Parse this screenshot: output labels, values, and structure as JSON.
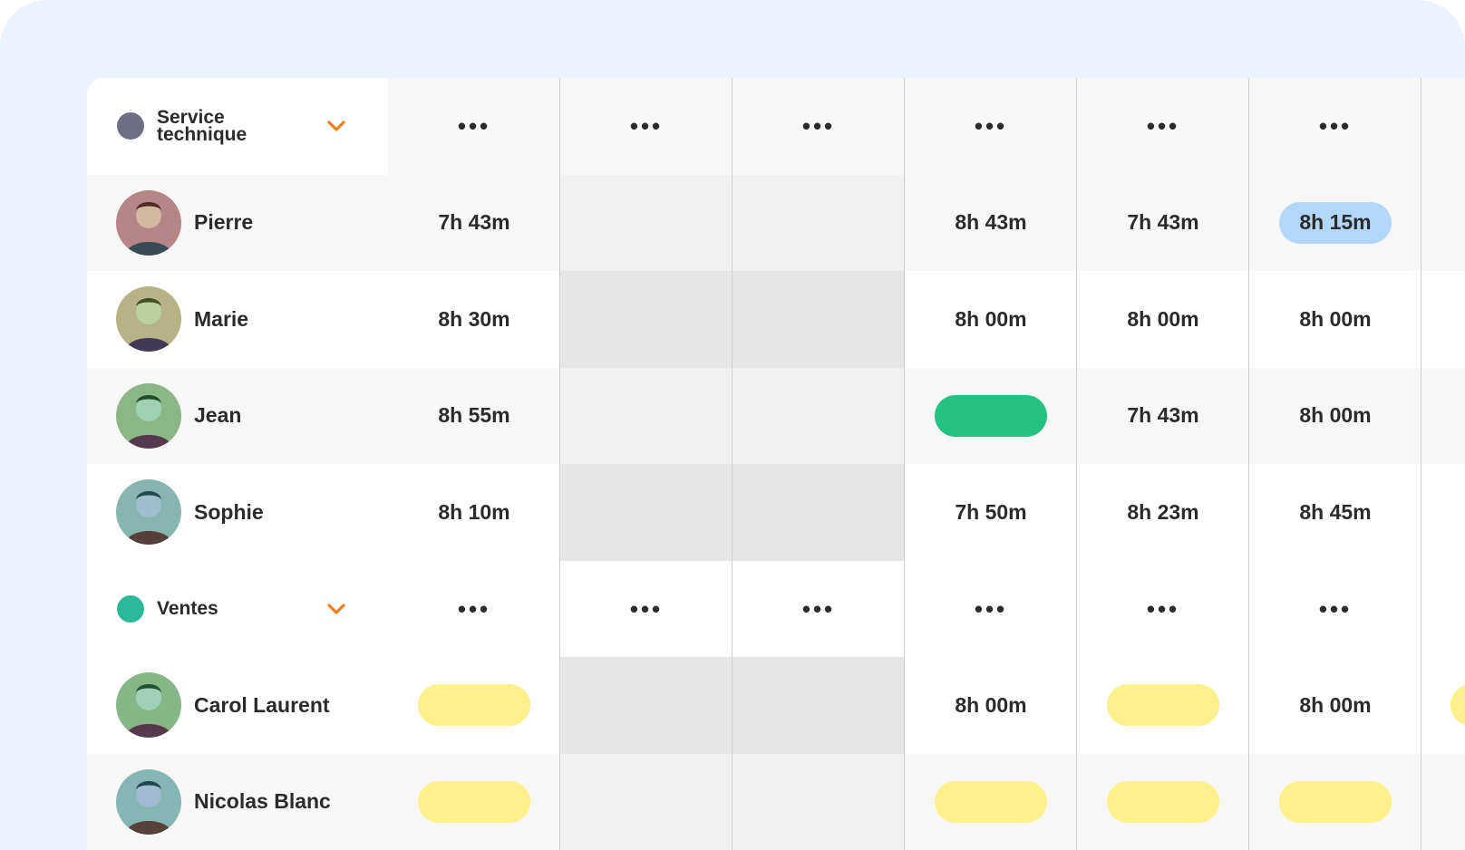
{
  "colors": {
    "frame_bg": "#ecf3fe",
    "group_service_dot": "#6e6e86",
    "group_ventes_dot": "#2cb79a",
    "chevron": "#f07d1a",
    "pill_blue": "#b3d7fb",
    "pill_green": "#23c283",
    "pill_yellow": "#fef08a",
    "weekend_col": "#f1f1f1",
    "alt_row": "#f7f7f7"
  },
  "groups": [
    {
      "name": "Service technique",
      "dot_color": "#6e6e86",
      "chevron_icon": "chevron-down-icon",
      "header_cells": [
        "•••",
        "•••",
        "•••",
        "•••",
        "•••",
        "•••"
      ],
      "members": [
        {
          "name": "Pierre",
          "avatar_icon": "avatar-photo",
          "cells": [
            {
              "type": "text",
              "value": "7h 43m"
            },
            {
              "type": "empty"
            },
            {
              "type": "empty"
            },
            {
              "type": "text",
              "value": "8h 43m"
            },
            {
              "type": "text",
              "value": "7h 43m"
            },
            {
              "type": "pill",
              "value": "8h 15m",
              "color": "#b3d7fb"
            }
          ]
        },
        {
          "name": "Marie",
          "avatar_icon": "avatar-photo",
          "cells": [
            {
              "type": "text",
              "value": "8h 30m"
            },
            {
              "type": "empty"
            },
            {
              "type": "empty"
            },
            {
              "type": "text",
              "value": "8h 00m"
            },
            {
              "type": "text",
              "value": "8h 00m"
            },
            {
              "type": "text",
              "value": "8h 00m"
            }
          ]
        },
        {
          "name": "Jean",
          "avatar_icon": "avatar-photo",
          "cells": [
            {
              "type": "text",
              "value": "8h 55m"
            },
            {
              "type": "empty"
            },
            {
              "type": "empty"
            },
            {
              "type": "pill",
              "value": "",
              "color": "#23c283"
            },
            {
              "type": "text",
              "value": "7h 43m"
            },
            {
              "type": "text",
              "value": "8h 00m"
            }
          ]
        },
        {
          "name": "Sophie",
          "avatar_icon": "avatar-photo",
          "cells": [
            {
              "type": "text",
              "value": "8h 10m"
            },
            {
              "type": "empty"
            },
            {
              "type": "empty"
            },
            {
              "type": "text",
              "value": "7h 50m"
            },
            {
              "type": "text",
              "value": "8h 23m"
            },
            {
              "type": "text",
              "value": "8h 45m"
            }
          ]
        }
      ]
    },
    {
      "name": "Ventes",
      "dot_color": "#2cb79a",
      "chevron_icon": "chevron-down-icon",
      "header_cells": [
        "•••",
        "•••",
        "•••",
        "•••",
        "•••",
        "•••"
      ],
      "members": [
        {
          "name": "Carol Laurent",
          "avatar_icon": "avatar-photo",
          "cells": [
            {
              "type": "pill",
              "value": "",
              "color": "#fef08a"
            },
            {
              "type": "empty"
            },
            {
              "type": "empty"
            },
            {
              "type": "text",
              "value": "8h 00m"
            },
            {
              "type": "pill",
              "value": "",
              "color": "#fef08a"
            },
            {
              "type": "text",
              "value": "8h 00m"
            }
          ]
        },
        {
          "name": "Nicolas Blanc",
          "avatar_icon": "avatar-photo",
          "cells": [
            {
              "type": "pill",
              "value": "",
              "color": "#fef08a"
            },
            {
              "type": "empty"
            },
            {
              "type": "empty"
            },
            {
              "type": "pill",
              "value": "",
              "color": "#fef08a"
            },
            {
              "type": "pill",
              "value": "",
              "color": "#fef08a"
            },
            {
              "type": "pill",
              "value": "",
              "color": "#fef08a"
            }
          ]
        }
      ]
    }
  ]
}
